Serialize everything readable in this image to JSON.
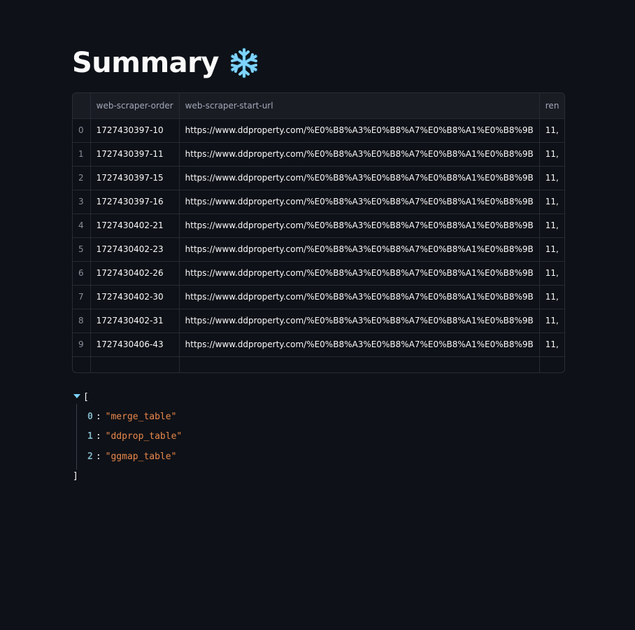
{
  "page": {
    "title": "Summary",
    "title_icon": "snowflake-icon"
  },
  "table": {
    "columns": [
      "",
      "web-scraper-order",
      "web-scraper-start-url",
      "ren"
    ],
    "rows": [
      {
        "index": "0",
        "order": "1727430397-10",
        "url": "https://www.ddproperty.com/%E0%B8%A3%E0%B8%A7%E0%B8%A1%E0%B8%9B",
        "ren": "11,"
      },
      {
        "index": "1",
        "order": "1727430397-11",
        "url": "https://www.ddproperty.com/%E0%B8%A3%E0%B8%A7%E0%B8%A1%E0%B8%9B",
        "ren": "11,"
      },
      {
        "index": "2",
        "order": "1727430397-15",
        "url": "https://www.ddproperty.com/%E0%B8%A3%E0%B8%A7%E0%B8%A1%E0%B8%9B",
        "ren": "11,"
      },
      {
        "index": "3",
        "order": "1727430397-16",
        "url": "https://www.ddproperty.com/%E0%B8%A3%E0%B8%A7%E0%B8%A1%E0%B8%9B",
        "ren": "11,"
      },
      {
        "index": "4",
        "order": "1727430402-21",
        "url": "https://www.ddproperty.com/%E0%B8%A3%E0%B8%A7%E0%B8%A1%E0%B8%9B",
        "ren": "11,"
      },
      {
        "index": "5",
        "order": "1727430402-23",
        "url": "https://www.ddproperty.com/%E0%B8%A3%E0%B8%A7%E0%B8%A1%E0%B8%9B",
        "ren": "11,"
      },
      {
        "index": "6",
        "order": "1727430402-26",
        "url": "https://www.ddproperty.com/%E0%B8%A3%E0%B8%A7%E0%B8%A1%E0%B8%9B",
        "ren": "11,"
      },
      {
        "index": "7",
        "order": "1727430402-30",
        "url": "https://www.ddproperty.com/%E0%B8%A3%E0%B8%A7%E0%B8%A1%E0%B8%9B",
        "ren": "11,"
      },
      {
        "index": "8",
        "order": "1727430402-31",
        "url": "https://www.ddproperty.com/%E0%B8%A3%E0%B8%A7%E0%B8%A1%E0%B8%9B",
        "ren": "11,"
      },
      {
        "index": "9",
        "order": "1727430406-43",
        "url": "https://www.ddproperty.com/%E0%B8%A3%E0%B8%A7%E0%B8%A1%E0%B8%9B",
        "ren": "11,"
      }
    ]
  },
  "json_viewer": {
    "open_bracket": "[",
    "close_bracket": "]",
    "items": [
      {
        "key": "0",
        "value": "\"merge_table\""
      },
      {
        "key": "1",
        "value": "\"ddprop_table\""
      },
      {
        "key": "2",
        "value": "\"ggmap_table\""
      }
    ]
  },
  "colors": {
    "background": "#0e1117",
    "icon": "#7dd3fc",
    "json_key": "#7fb4c4",
    "json_string": "#e8874b"
  }
}
